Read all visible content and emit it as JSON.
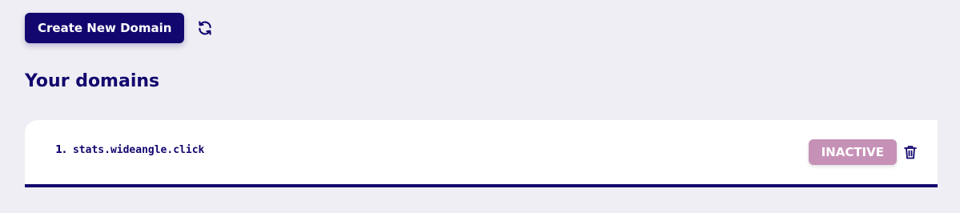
{
  "toolbar": {
    "create_label": "Create New Domain",
    "refresh_icon": "refresh-icon"
  },
  "section": {
    "title": "Your domains"
  },
  "domains": [
    {
      "index": "1.",
      "name": "stats.wideangle.click",
      "status": "INACTIVE",
      "delete_icon": "trash-icon"
    }
  ],
  "colors": {
    "primary": "#12076e",
    "background": "#efeef4",
    "inactive_badge": "#c691b7",
    "card": "#ffffff"
  }
}
